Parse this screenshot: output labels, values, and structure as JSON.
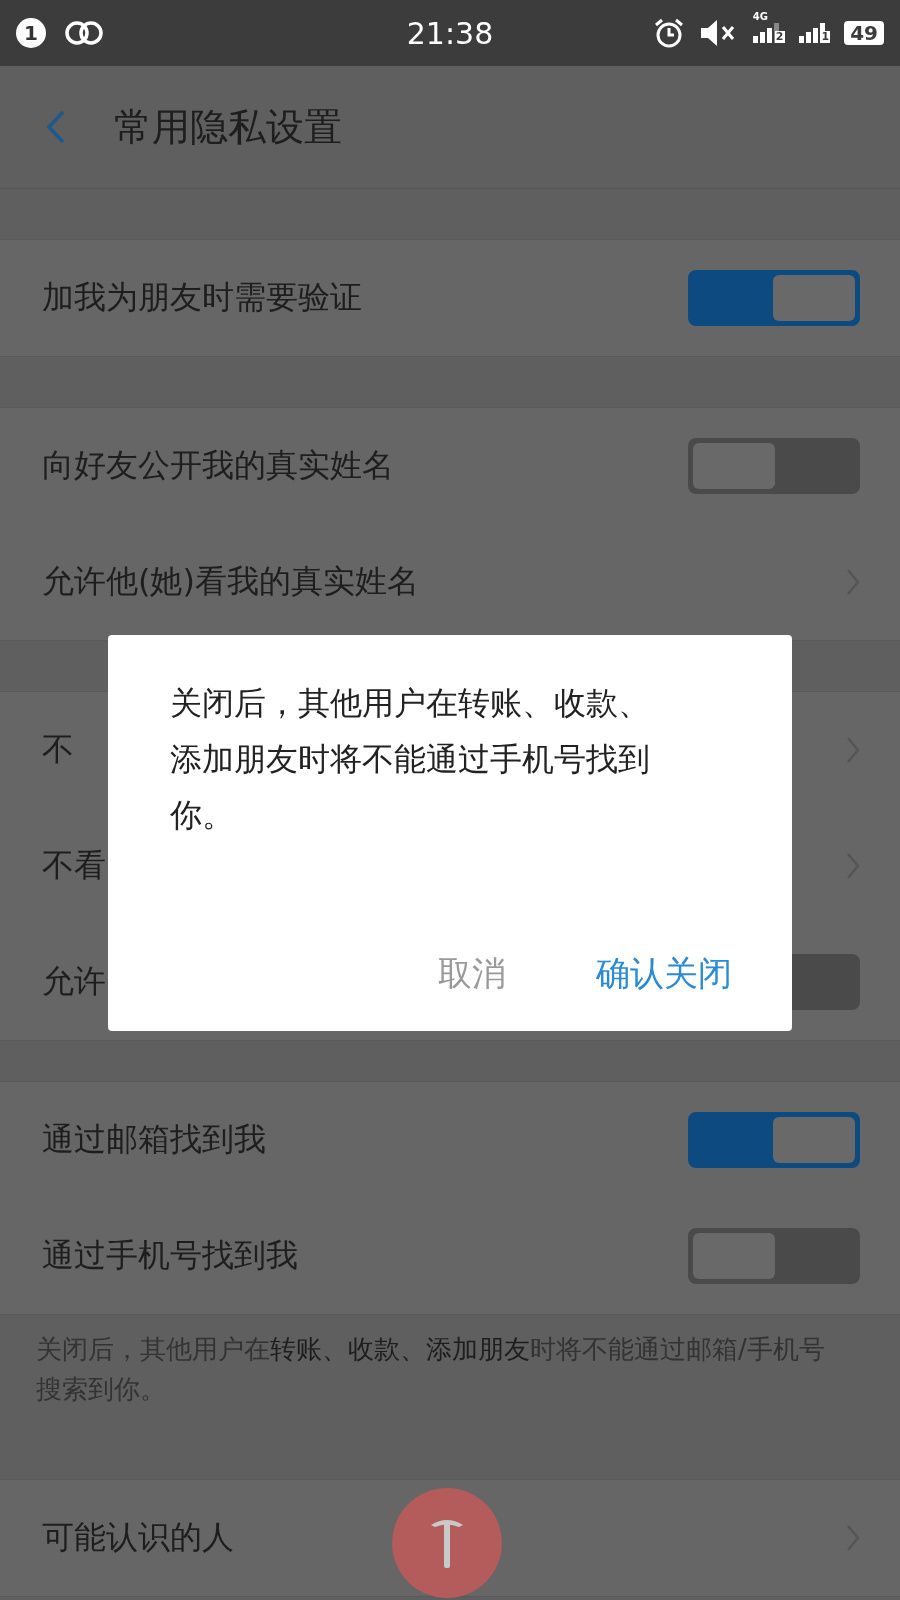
{
  "status_bar": {
    "notification_count": "1",
    "time": "21:38",
    "network": "4G",
    "sim_2": "2",
    "sim_1": "1",
    "battery": "49"
  },
  "header": {
    "title": "常用隐私设置"
  },
  "sections": [
    {
      "items": [
        {
          "kind": "toggle",
          "label": "加我为朋友时需要验证",
          "on": true
        }
      ]
    },
    {
      "items": [
        {
          "kind": "toggle",
          "label": "向好友公开我的真实姓名",
          "on": false
        },
        {
          "kind": "link",
          "label": "允许他(她)看我的真实姓名"
        }
      ]
    },
    {
      "items": [
        {
          "kind": "link",
          "label": "不"
        },
        {
          "kind": "link",
          "label": "不看"
        },
        {
          "kind": "toggle",
          "label": "允许",
          "on": false
        }
      ]
    },
    {
      "items": [
        {
          "kind": "toggle",
          "label": "通过邮箱找到我",
          "on": true
        },
        {
          "kind": "toggle",
          "label": "通过手机号找到我",
          "on": false
        }
      ],
      "footnote": "关闭后，其他用户在**转账、收款、添加朋友**时将不能通过邮箱/手机号搜索到你。"
    },
    {
      "items": [
        {
          "kind": "link",
          "label": "可能认识的人"
        }
      ]
    }
  ],
  "dialog": {
    "message": "关闭后，其他用户在转账、收款、添加朋友时将不能通过手机号找到你。",
    "buttons": [
      {
        "kind": "cancel",
        "label": "取消"
      },
      {
        "kind": "confirm",
        "label": "确认关闭"
      }
    ]
  }
}
